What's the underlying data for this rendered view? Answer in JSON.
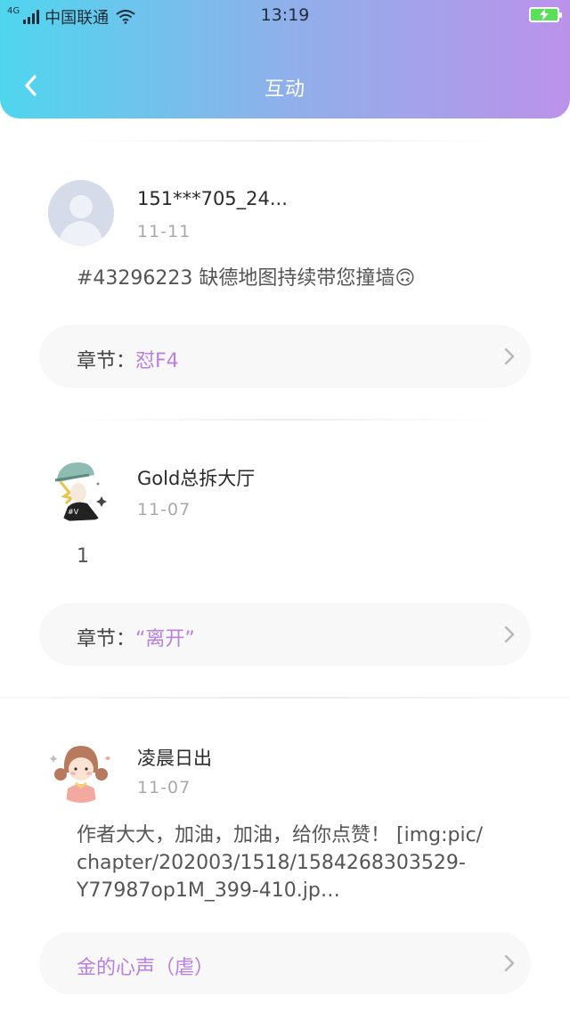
{
  "status_bar": {
    "network": "4G",
    "carrier": "中国联通",
    "time": "13:19"
  },
  "header": {
    "title": "互动"
  },
  "posts": [
    {
      "username": "151***705_24...",
      "date": "11-11",
      "content": "#43296223 缺德地图持续带您撞墙🙃",
      "chapter_prefix": "章节：",
      "chapter_name": "怼F4"
    },
    {
      "username": "Gold总拆大厅",
      "date": "11-07",
      "content": "1",
      "chapter_prefix": "章节：",
      "chapter_name": "“离开”"
    },
    {
      "username": "凌晨日出",
      "date": "11-07",
      "content_lines": [
        "作者大大，加油，加油，给你点赞！ [img:pic/",
        "chapter/202003/1518/1584268303529-",
        "Y77987op1M_399-410.jp…"
      ],
      "chapter_prefix": "",
      "chapter_name": "金的心声（虐）"
    }
  ],
  "colors": {
    "header_gradient_start": "#4fd6ee",
    "header_gradient_end": "#bb92ea",
    "chapter_accent": "#b880e0",
    "date_gray": "#a9a9a9"
  }
}
